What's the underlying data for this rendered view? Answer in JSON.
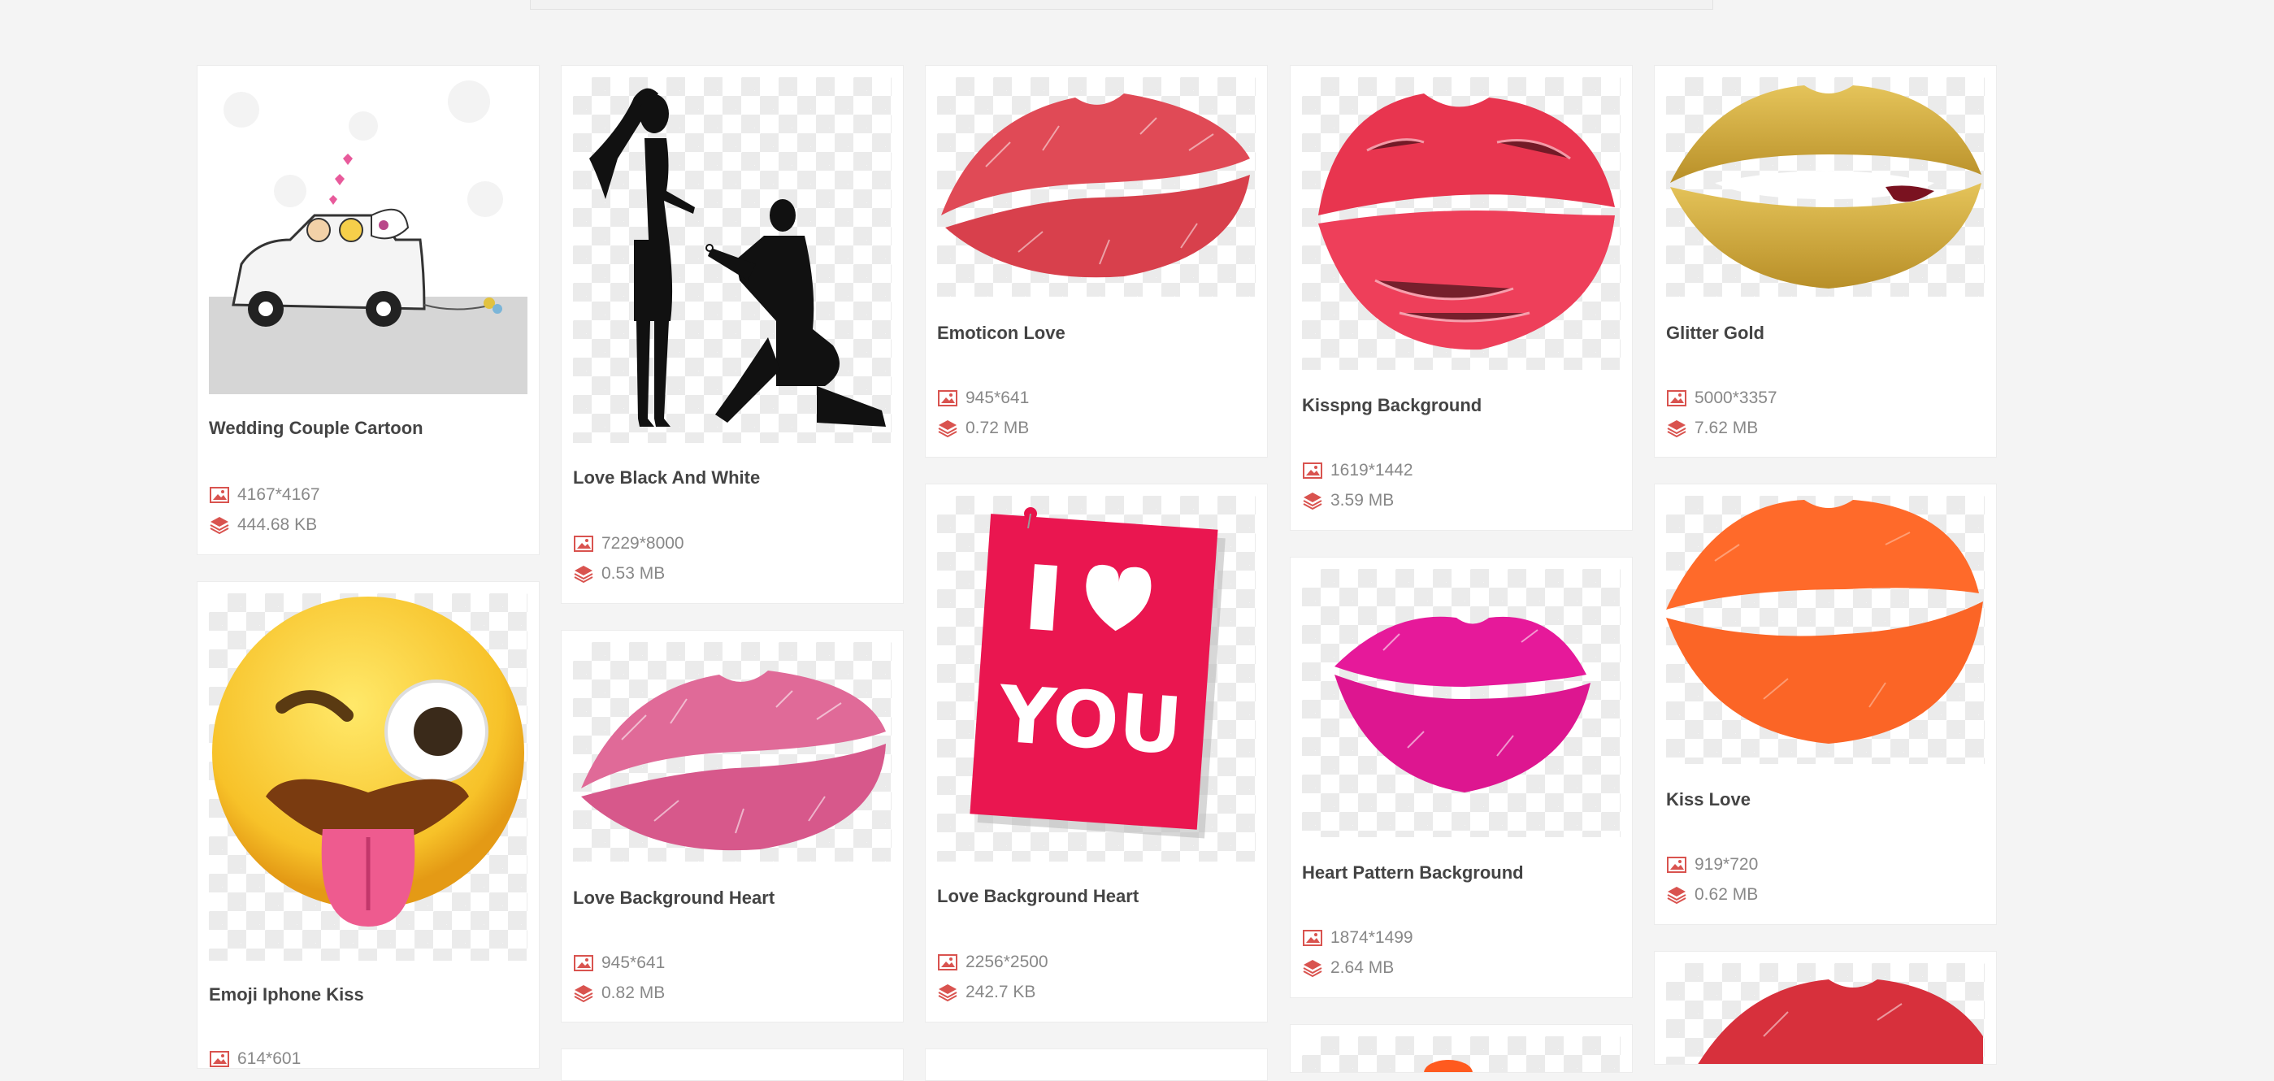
{
  "cards": [
    {
      "title": "Wedding Couple Cartoon",
      "dims": "4167*4167",
      "size": "444.68 KB",
      "image": "wedding-car-cartoon"
    },
    {
      "title": "Emoji Iphone Kiss",
      "dims": "614*601",
      "size": "",
      "image": "winking-tongue-emoji"
    },
    {
      "title": "Love Black And White",
      "dims": "7229*8000",
      "size": "0.53 MB",
      "image": "proposal-silhouette"
    },
    {
      "title": "Love Background Heart",
      "dims": "945*641",
      "size": "0.82 MB",
      "image": "pink-lipstick-kiss"
    },
    {
      "title": "Emoticon Love",
      "dims": "945*641",
      "size": "0.72 MB",
      "image": "red-lipstick-kiss"
    },
    {
      "title": "Love Background Heart",
      "dims": "2256*2500",
      "size": "242.7 KB",
      "image": "i-love-you-note"
    },
    {
      "title": "Kisspng Background",
      "dims": "1619*1442",
      "size": "3.59 MB",
      "image": "red-glossy-lips"
    },
    {
      "title": "Heart Pattern Background",
      "dims": "1874*1499",
      "size": "2.64 MB",
      "image": "magenta-lipstick-kiss"
    },
    {
      "title": "Glitter Gold",
      "dims": "5000*3357",
      "size": "7.62 MB",
      "image": "gold-glitter-lips"
    },
    {
      "title": "Kiss Love",
      "dims": "919*720",
      "size": "0.62 MB",
      "image": "orange-lips"
    }
  ],
  "colors": {
    "accent": "#d9534f",
    "title": "#444444",
    "meta": "#888888",
    "background": "#f4f4f4"
  },
  "icons": {
    "dimensions": "image-icon",
    "filesize": "layers-icon"
  }
}
